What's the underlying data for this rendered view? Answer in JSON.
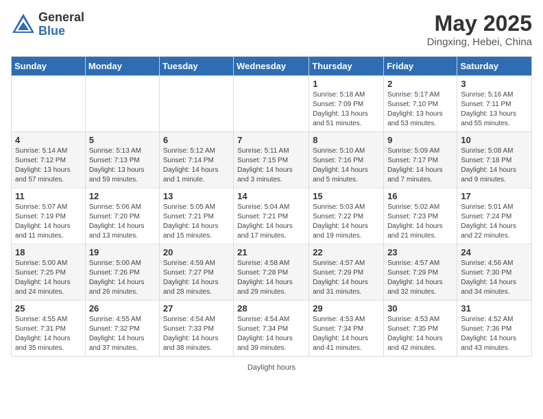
{
  "header": {
    "logo_general": "General",
    "logo_blue": "Blue",
    "month_title": "May 2025",
    "subtitle": "Dingxing, Hebei, China"
  },
  "days_of_week": [
    "Sunday",
    "Monday",
    "Tuesday",
    "Wednesday",
    "Thursday",
    "Friday",
    "Saturday"
  ],
  "weeks": [
    [
      {
        "day": "",
        "info": ""
      },
      {
        "day": "",
        "info": ""
      },
      {
        "day": "",
        "info": ""
      },
      {
        "day": "",
        "info": ""
      },
      {
        "day": "1",
        "info": "Sunrise: 5:18 AM\nSunset: 7:09 PM\nDaylight: 13 hours\nand 51 minutes."
      },
      {
        "day": "2",
        "info": "Sunrise: 5:17 AM\nSunset: 7:10 PM\nDaylight: 13 hours\nand 53 minutes."
      },
      {
        "day": "3",
        "info": "Sunrise: 5:16 AM\nSunset: 7:11 PM\nDaylight: 13 hours\nand 55 minutes."
      }
    ],
    [
      {
        "day": "4",
        "info": "Sunrise: 5:14 AM\nSunset: 7:12 PM\nDaylight: 13 hours\nand 57 minutes."
      },
      {
        "day": "5",
        "info": "Sunrise: 5:13 AM\nSunset: 7:13 PM\nDaylight: 13 hours\nand 59 minutes."
      },
      {
        "day": "6",
        "info": "Sunrise: 5:12 AM\nSunset: 7:14 PM\nDaylight: 14 hours\nand 1 minute."
      },
      {
        "day": "7",
        "info": "Sunrise: 5:11 AM\nSunset: 7:15 PM\nDaylight: 14 hours\nand 3 minutes."
      },
      {
        "day": "8",
        "info": "Sunrise: 5:10 AM\nSunset: 7:16 PM\nDaylight: 14 hours\nand 5 minutes."
      },
      {
        "day": "9",
        "info": "Sunrise: 5:09 AM\nSunset: 7:17 PM\nDaylight: 14 hours\nand 7 minutes."
      },
      {
        "day": "10",
        "info": "Sunrise: 5:08 AM\nSunset: 7:18 PM\nDaylight: 14 hours\nand 9 minutes."
      }
    ],
    [
      {
        "day": "11",
        "info": "Sunrise: 5:07 AM\nSunset: 7:19 PM\nDaylight: 14 hours\nand 11 minutes."
      },
      {
        "day": "12",
        "info": "Sunrise: 5:06 AM\nSunset: 7:20 PM\nDaylight: 14 hours\nand 13 minutes."
      },
      {
        "day": "13",
        "info": "Sunrise: 5:05 AM\nSunset: 7:21 PM\nDaylight: 14 hours\nand 15 minutes."
      },
      {
        "day": "14",
        "info": "Sunrise: 5:04 AM\nSunset: 7:21 PM\nDaylight: 14 hours\nand 17 minutes."
      },
      {
        "day": "15",
        "info": "Sunrise: 5:03 AM\nSunset: 7:22 PM\nDaylight: 14 hours\nand 19 minutes."
      },
      {
        "day": "16",
        "info": "Sunrise: 5:02 AM\nSunset: 7:23 PM\nDaylight: 14 hours\nand 21 minutes."
      },
      {
        "day": "17",
        "info": "Sunrise: 5:01 AM\nSunset: 7:24 PM\nDaylight: 14 hours\nand 22 minutes."
      }
    ],
    [
      {
        "day": "18",
        "info": "Sunrise: 5:00 AM\nSunset: 7:25 PM\nDaylight: 14 hours\nand 24 minutes."
      },
      {
        "day": "19",
        "info": "Sunrise: 5:00 AM\nSunset: 7:26 PM\nDaylight: 14 hours\nand 26 minutes."
      },
      {
        "day": "20",
        "info": "Sunrise: 4:59 AM\nSunset: 7:27 PM\nDaylight: 14 hours\nand 28 minutes."
      },
      {
        "day": "21",
        "info": "Sunrise: 4:58 AM\nSunset: 7:28 PM\nDaylight: 14 hours\nand 29 minutes."
      },
      {
        "day": "22",
        "info": "Sunrise: 4:57 AM\nSunset: 7:29 PM\nDaylight: 14 hours\nand 31 minutes."
      },
      {
        "day": "23",
        "info": "Sunrise: 4:57 AM\nSunset: 7:29 PM\nDaylight: 14 hours\nand 32 minutes."
      },
      {
        "day": "24",
        "info": "Sunrise: 4:56 AM\nSunset: 7:30 PM\nDaylight: 14 hours\nand 34 minutes."
      }
    ],
    [
      {
        "day": "25",
        "info": "Sunrise: 4:55 AM\nSunset: 7:31 PM\nDaylight: 14 hours\nand 35 minutes."
      },
      {
        "day": "26",
        "info": "Sunrise: 4:55 AM\nSunset: 7:32 PM\nDaylight: 14 hours\nand 37 minutes."
      },
      {
        "day": "27",
        "info": "Sunrise: 4:54 AM\nSunset: 7:33 PM\nDaylight: 14 hours\nand 38 minutes."
      },
      {
        "day": "28",
        "info": "Sunrise: 4:54 AM\nSunset: 7:34 PM\nDaylight: 14 hours\nand 39 minutes."
      },
      {
        "day": "29",
        "info": "Sunrise: 4:53 AM\nSunset: 7:34 PM\nDaylight: 14 hours\nand 41 minutes."
      },
      {
        "day": "30",
        "info": "Sunrise: 4:53 AM\nSunset: 7:35 PM\nDaylight: 14 hours\nand 42 minutes."
      },
      {
        "day": "31",
        "info": "Sunrise: 4:52 AM\nSunset: 7:36 PM\nDaylight: 14 hours\nand 43 minutes."
      }
    ]
  ],
  "footer": "Daylight hours"
}
